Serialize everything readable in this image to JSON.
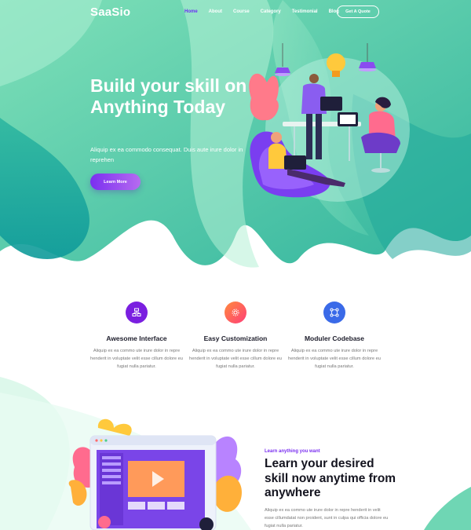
{
  "brand": {
    "logo": "SaaSio"
  },
  "nav": {
    "items": [
      {
        "label": "Home",
        "active": true
      },
      {
        "label": "About",
        "active": false
      },
      {
        "label": "Course",
        "active": false
      },
      {
        "label": "Category",
        "active": false
      },
      {
        "label": "Testimonial",
        "active": false
      },
      {
        "label": "Blog",
        "active": false
      }
    ],
    "cta_label": "Get A Quote"
  },
  "hero": {
    "title": "Build your skill on Anything Today",
    "subtitle": "Aliquip ex ea commodo consequat. Duis aute irure dolor in reprehen",
    "button_label": "Learn More"
  },
  "features": [
    {
      "title": "Awesome Interface",
      "text": "Aliquip ex ea commo ute irure dolor in repre henderit in voluptate velit esse cillum dolore eu fugiat nulla pariatur.",
      "icon": "layout-icon",
      "color": "#7a1fe0"
    },
    {
      "title": "Easy Customization",
      "text": "Aliquip ex ea commo ute irure dolor in repre henderit in voluptate velit esse cillum dolore eu fugiat nulla pariatur.",
      "icon": "gear-icon",
      "color": "#ff5a57"
    },
    {
      "title": "Moduler Codebase",
      "text": "Aliquip ex ea commo ute irure dolor in repre henderit in voluptate velit esse cillum dolore eu fugiat nulla pariatur.",
      "icon": "modules-icon",
      "color": "#3a6ae8"
    }
  ],
  "learn_section": {
    "eyebrow": "Learn anything you want",
    "title": "Learn your desired skill now anytime from anywhere",
    "text": "Aliquip ex ea commo ute irure dolor in repre henderit in velit esse cillumdatat non proident, sunt in culpa qui officia dolore eu fugiat nulla pariatur."
  },
  "colors": {
    "accent": "#7a2ff0",
    "hero_teal": "#26b89a",
    "hero_light": "#8be3c3"
  }
}
